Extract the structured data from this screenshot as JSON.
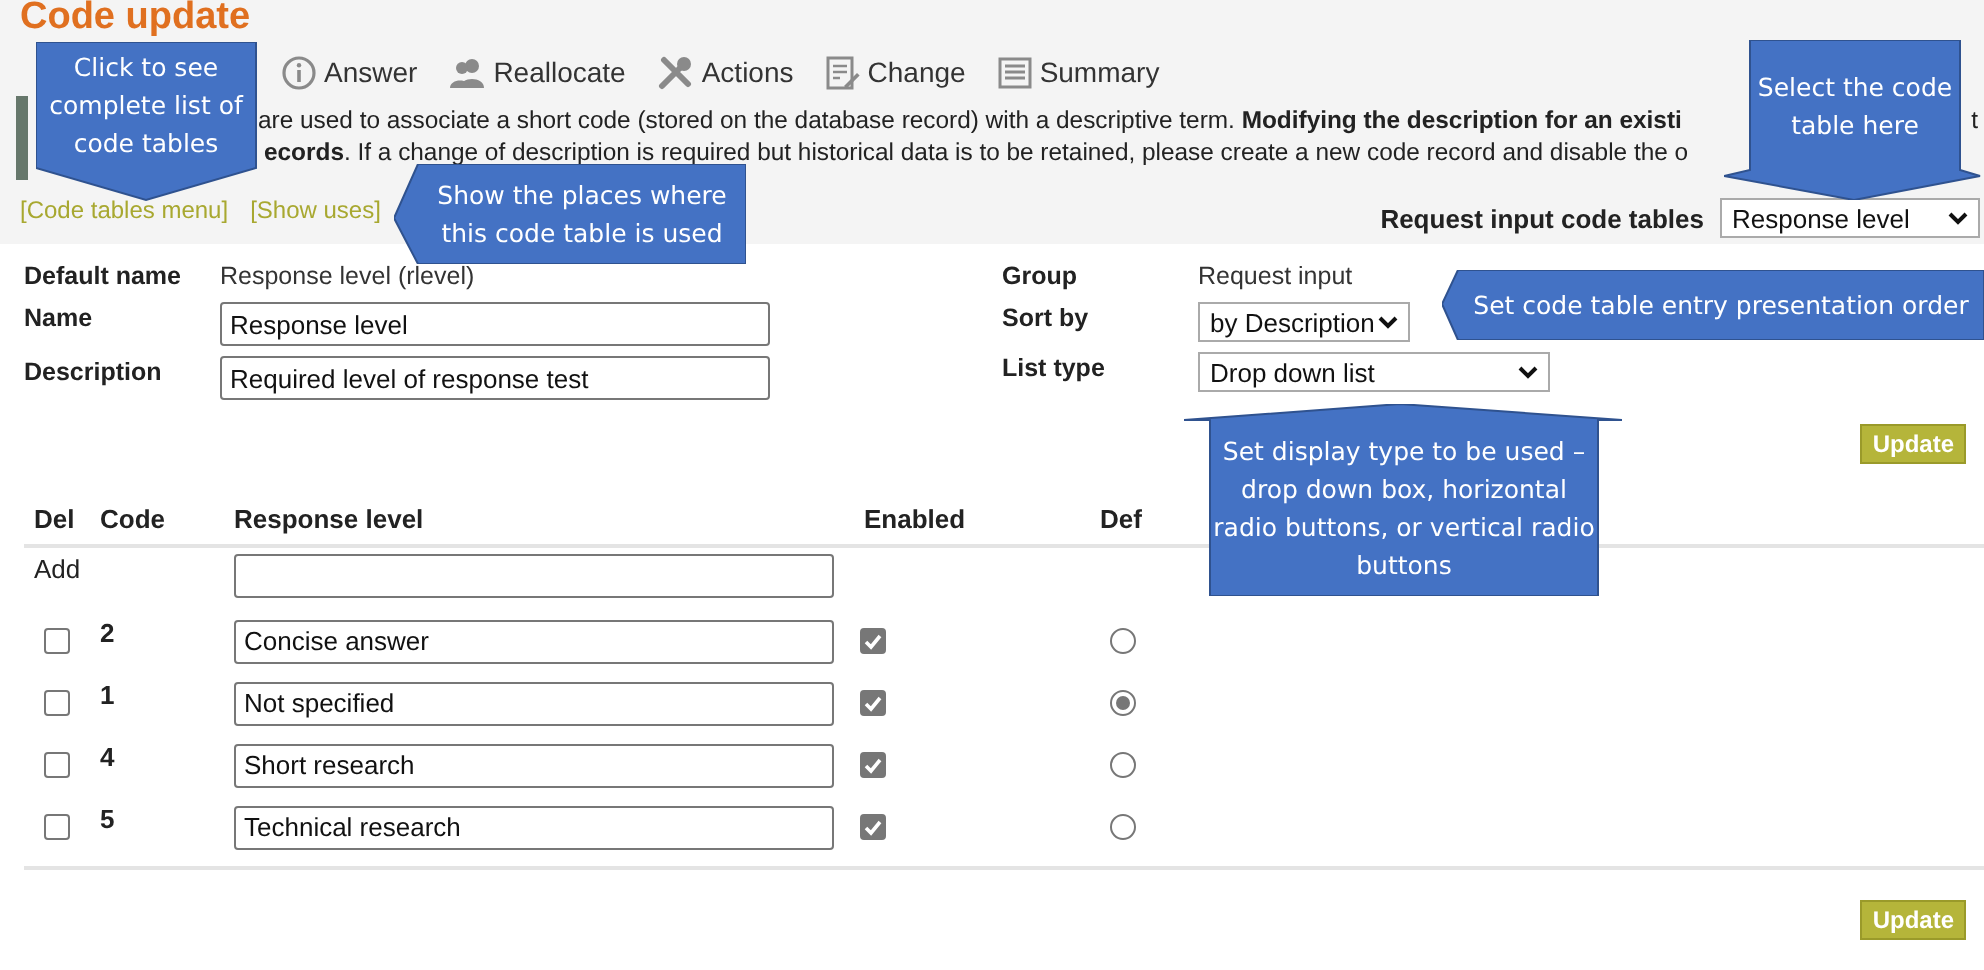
{
  "title": "Code update",
  "toolbar": [
    {
      "label": "Answer",
      "kind": "info"
    },
    {
      "label": "Reallocate",
      "kind": "people"
    },
    {
      "label": "Actions",
      "kind": "tools"
    },
    {
      "label": "Change",
      "kind": "edit"
    },
    {
      "label": "Summary",
      "kind": "list"
    }
  ],
  "intro": {
    "line_1": "are used to associate a short code (stored on the database record) with a descriptive term. **Modifying the description for an existi**",
    "line_1_end": "t",
    "line_2": "**ecords**. If a change of description is required but historical data is to be retained, please create a new code record and disable the o"
  },
  "links": [
    "[Code tables menu]",
    "[Show uses]"
  ],
  "table_picker": {
    "label": "Request input code tables",
    "value": "Response level"
  },
  "form": {
    "default_name": {
      "label": "Default name",
      "value": "Response level (rlevel)"
    },
    "name": {
      "label": "Name",
      "value": "Response level"
    },
    "description": {
      "label": "Description",
      "value": "Required level of response test"
    },
    "group": {
      "label": "Group",
      "value": "Request input"
    },
    "sort_by": {
      "label": "Sort by",
      "value": "by Description"
    },
    "list_type": {
      "label": "List type",
      "value": "Drop down list"
    }
  },
  "update_buttons": [
    "Update",
    "Update"
  ],
  "table": {
    "columns": [
      "Del",
      "Code",
      "Response level",
      "Enabled",
      "Def"
    ],
    "add_label": "Add",
    "rows": [
      {
        "delete": false,
        "code": "2",
        "name": "Concise answer",
        "enabled": true,
        "selected": false
      },
      {
        "delete": false,
        "code": "1",
        "name": "Not specified",
        "enabled": true,
        "selected": true
      },
      {
        "delete": false,
        "code": "4",
        "name": "Short research",
        "enabled": true,
        "selected": false
      },
      {
        "delete": false,
        "code": "5",
        "name": "Technical research",
        "enabled": true,
        "selected": false
      }
    ]
  },
  "callouts": [
    {
      "text": "Click to see complete list of code tables"
    },
    {
      "text": "Show the places where this code table is used"
    },
    {
      "text": "Select the code table here"
    },
    {
      "text": "Set code table entry presentation order"
    },
    {
      "text": "Set display type to be used – drop down box, horizontal radio buttons, or vertical radio buttons"
    }
  ]
}
